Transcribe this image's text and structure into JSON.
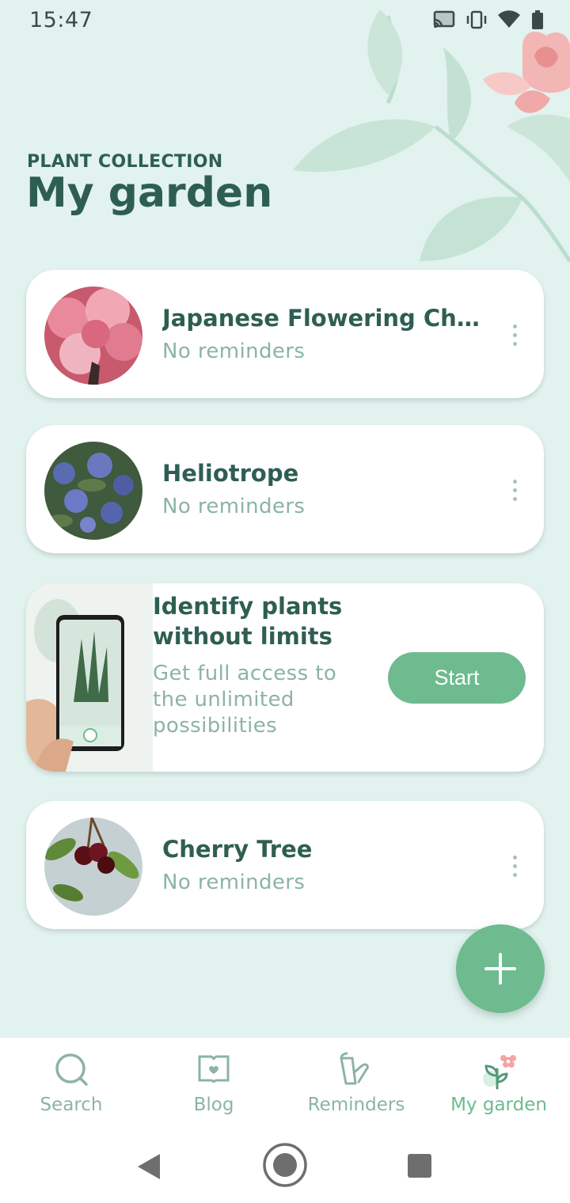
{
  "status_bar": {
    "time": "15:47"
  },
  "header": {
    "subtitle": "PLANT COLLECTION",
    "title": "My garden"
  },
  "plants": [
    {
      "name": "Japanese Flowering Cherry",
      "reminder": "No reminders"
    },
    {
      "name": "Heliotrope",
      "reminder": "No reminders"
    },
    {
      "name": "Cherry Tree",
      "reminder": "No reminders"
    }
  ],
  "promo": {
    "title": "Identify plants without limits",
    "text": "Get full access to the unlimited possibilities",
    "button_label": "Start"
  },
  "bottom_nav": [
    {
      "label": "Search",
      "icon": "search-icon"
    },
    {
      "label": "Blog",
      "icon": "blog-icon"
    },
    {
      "label": "Reminders",
      "icon": "watering-can-icon"
    },
    {
      "label": "My garden",
      "icon": "plant-icon",
      "active": true
    }
  ],
  "colors": {
    "accent": "#6dbb8f",
    "text_dark": "#2e5e52",
    "text_muted": "#8cb3a8",
    "background": "#e2f2ee"
  }
}
